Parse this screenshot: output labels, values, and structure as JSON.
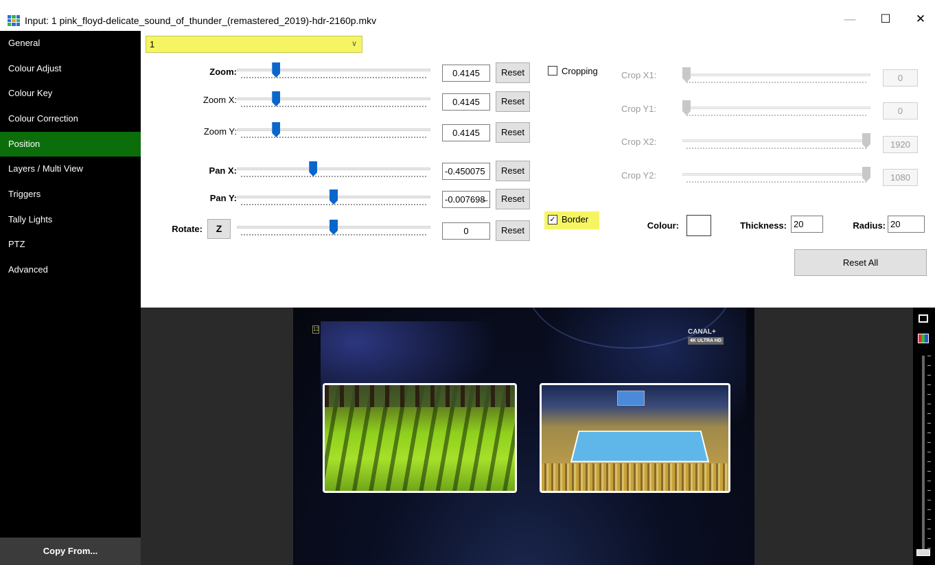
{
  "window": {
    "title": "Input: 1 pink_floyd-delicate_sound_of_thunder_(remastered_2019)-hdr-2160p.mkv",
    "minimize": "—",
    "maximize": "☐",
    "close": "✕"
  },
  "sidebar": {
    "items": [
      {
        "label": "General"
      },
      {
        "label": "Colour Adjust"
      },
      {
        "label": "Colour Key"
      },
      {
        "label": "Colour Correction"
      },
      {
        "label": "Position"
      },
      {
        "label": "Layers / Multi View"
      },
      {
        "label": "Triggers"
      },
      {
        "label": "Tally Lights"
      },
      {
        "label": "PTZ"
      },
      {
        "label": "Advanced"
      }
    ],
    "active": "Position",
    "copy_from": "Copy From..."
  },
  "layer_select": {
    "value": "1"
  },
  "position": {
    "zoom": {
      "label": "Zoom:",
      "value": "0.4145",
      "slider": 0.19
    },
    "zoom_x": {
      "label": "Zoom X:",
      "value": "0.4145",
      "slider": 0.19
    },
    "zoom_y": {
      "label": "Zoom Y:",
      "value": "0.4145",
      "slider": 0.19
    },
    "pan_x": {
      "label": "Pan X:",
      "value": "-0.450075",
      "slider": 0.39
    },
    "pan_y": {
      "label": "Pan Y:",
      "value": "-0.007698̶",
      "slider": 0.5
    },
    "rotate": {
      "label": "Rotate:",
      "axis_button": "Z",
      "value": "0",
      "slider": 0.5
    },
    "reset_label": "Reset"
  },
  "crop": {
    "checkbox_label": "Cropping",
    "checked": false,
    "x1": {
      "label": "Crop X1:",
      "value": "0",
      "slider": 0.0
    },
    "y1": {
      "label": "Crop Y1:",
      "value": "0",
      "slider": 0.0
    },
    "x2": {
      "label": "Crop X2:",
      "value": "1920",
      "slider": 1.0
    },
    "y2": {
      "label": "Crop Y2:",
      "value": "1080",
      "slider": 1.0
    }
  },
  "border": {
    "checkbox_label": "Border",
    "checked": true,
    "colour_label": "Colour:",
    "colour_value": "#ffffff",
    "thickness_label": "Thickness:",
    "thickness_value": "20",
    "radius_label": "Radius:",
    "radius_value": "20"
  },
  "reset_all": "Reset All",
  "preview": {
    "age_badge": "12",
    "channel_logo": "CANAL+",
    "channel_badge": "4K ULTRA HD"
  },
  "colors": {
    "active_sidebar": "#0b6e0b",
    "highlight": "#f5f564",
    "slider_thumb": "#0a66cc"
  }
}
